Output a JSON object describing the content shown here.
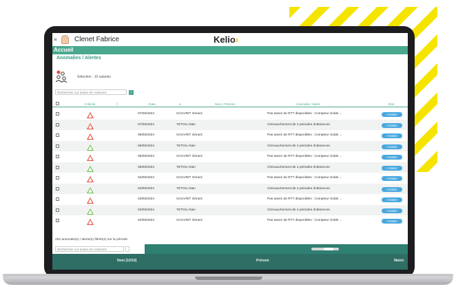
{
  "header": {
    "username": "Clenet Fabrice",
    "logo": "Kelio",
    "hamburger_icon": "menu-icon"
  },
  "nav": {
    "section": "Accueil",
    "breadcrumb": "Anomalies / Alertes"
  },
  "selection": {
    "text": "Sélection : 10 salariés",
    "search_placeholder": "Rechercher sur toutes les colonnes"
  },
  "table": {
    "headers": {
      "criticite": "Criticité",
      "date": "Date",
      "nom": "Nom / Prénom",
      "anomalie": "Anomalie / Alerte",
      "etat": "État"
    },
    "rows": [
      {
        "criticite": "red",
        "date": "07/06/2024",
        "nom": "GAUVRIT Gérard",
        "anomalie": "Pas assez de RTT disponibles : Compteur Solde ...",
        "etat": "A traiter"
      },
      {
        "criticite": "red",
        "date": "07/06/2024",
        "nom": "TETOU Alain",
        "anomalie": "Chevauchement de 2 périodes d'absences",
        "etat": "A traiter"
      },
      {
        "criticite": "red",
        "date": "06/06/2024",
        "nom": "GAUVRIT Gérard",
        "anomalie": "Pas assez de RTT disponibles : Compteur Solde ...",
        "etat": "A traiter"
      },
      {
        "criticite": "green",
        "date": "06/06/2024",
        "nom": "TETOU Alain",
        "anomalie": "Chevauchement de 2 périodes d'absences",
        "etat": "A traiter"
      },
      {
        "criticite": "red",
        "date": "05/06/2024",
        "nom": "GAUVRIT Gérard",
        "anomalie": "Pas assez de RTT disponibles : Compteur Solde ...",
        "etat": "A traiter"
      },
      {
        "criticite": "green",
        "date": "05/06/2024",
        "nom": "TETOU Alain",
        "anomalie": "Chevauchement de 2 périodes d'absences",
        "etat": "A traiter"
      },
      {
        "criticite": "red",
        "date": "04/06/2024",
        "nom": "GAUVRIT Gérard",
        "anomalie": "Pas assez de RTT disponibles : Compteur Solde ...",
        "etat": "A traiter"
      },
      {
        "criticite": "green",
        "date": "04/06/2024",
        "nom": "TETOU Alain",
        "anomalie": "Chevauchement de 2 périodes d'absences",
        "etat": "A traiter"
      },
      {
        "criticite": "red",
        "date": "03/06/2024",
        "nom": "GAUVRIT Gérard",
        "anomalie": "Pas assez de RTT disponibles : Compteur Solde ...",
        "etat": "A traiter"
      },
      {
        "criticite": "green",
        "date": "03/06/2024",
        "nom": "TETOU Alain",
        "anomalie": "Chevauchement de 2 périodes d'absences",
        "etat": "A traiter"
      },
      {
        "criticite": "red",
        "date": "02/06/2024",
        "nom": "GAUVRIT Gérard",
        "anomalie": "Pas assez de RTT disponibles : Compteur Solde ...",
        "etat": "A traiter"
      }
    ]
  },
  "summary": "252 anomalie(s) / alerte(s) filtrée(s) sur la période",
  "bottom": {
    "search_placeholder": "Rechercher sur toutes les colonnes",
    "col1": "Nom [10/10]",
    "col2": "Prénom",
    "col3": "Matric"
  },
  "colors": {
    "accent": "#4aa88f",
    "badge": "#4aa8df",
    "warn_red": "#e74c3c",
    "warn_green": "#6cc04a",
    "stripes": "#f5e400"
  }
}
